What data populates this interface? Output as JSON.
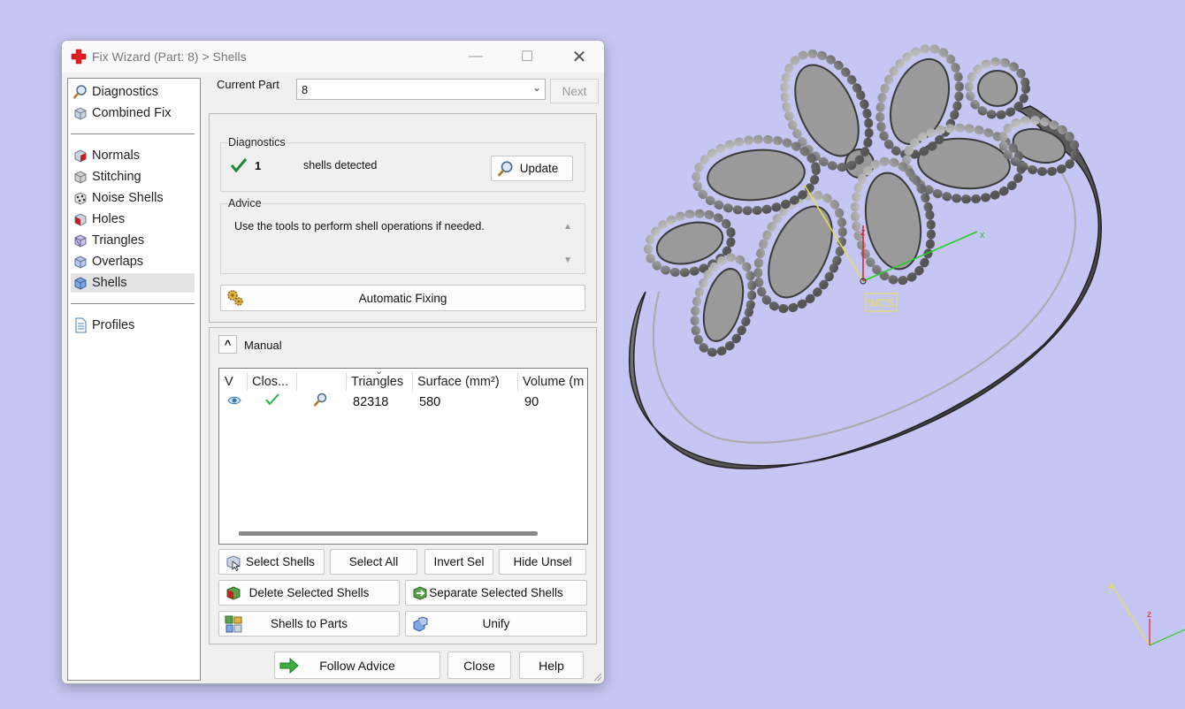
{
  "window": {
    "title": "Fix Wizard (Part: 8) > Shells",
    "min_symbol": "—",
    "max_symbol": "☐",
    "close_symbol": "✕"
  },
  "nav": {
    "group1": [
      {
        "label": "Diagnostics",
        "icon": "magnifier-icon"
      },
      {
        "label": "Combined Fix",
        "icon": "cube-icon"
      }
    ],
    "group2": [
      {
        "label": "Normals",
        "icon": "normals-cube-icon"
      },
      {
        "label": "Stitching",
        "icon": "stitching-cube-icon"
      },
      {
        "label": "Noise Shells",
        "icon": "noise-shells-icon"
      },
      {
        "label": "Holes",
        "icon": "holes-cube-icon"
      },
      {
        "label": "Triangles",
        "icon": "triangles-cube-icon"
      },
      {
        "label": "Overlaps",
        "icon": "overlaps-cube-icon"
      },
      {
        "label": "Shells",
        "icon": "shells-cube-icon",
        "selected": true
      }
    ],
    "group3": [
      {
        "label": "Profiles",
        "icon": "document-icon"
      }
    ]
  },
  "current_part": {
    "label": "Current Part",
    "value": "8",
    "next_label": "Next"
  },
  "diagnostics": {
    "title": "Diagnostics",
    "count": "1",
    "message": "shells detected",
    "update_label": "Update"
  },
  "advice": {
    "title": "Advice",
    "text": "Use the tools to perform shell operations if needed.",
    "scroll_up": "▲",
    "scroll_down": "▼"
  },
  "automatic_fixing_label": "Automatic Fixing",
  "manual": {
    "collapse_symbol": "^",
    "title": "Manual",
    "sort_indicator": "⌄",
    "columns": [
      "V",
      "Clos...",
      "",
      "Triangles",
      "Surface (mm²)",
      "Volume (m"
    ],
    "rows": [
      {
        "visible": "eye-icon",
        "closed": "check-icon",
        "inspect": "magnifier-icon",
        "triangles": "82318",
        "surface": "580",
        "volume": "90"
      }
    ],
    "buttons": {
      "select_shells": "Select Shells",
      "select_all": "Select All",
      "invert_sel": "Invert Sel",
      "hide_unsel": "Hide Unsel",
      "delete_selected": "Delete Selected Shells",
      "separate_selected": "Separate Selected Shells",
      "shells_to_parts": "Shells to Parts",
      "unify": "Unify"
    }
  },
  "bottom": {
    "follow_advice": "Follow Advice",
    "close": "Close",
    "help": "Help"
  },
  "viewport": {
    "wcs_label": "WCS",
    "axis_x": "x",
    "axis_z": "z",
    "mini_axis_z": "z",
    "mini_axis_y": "y",
    "colors": {
      "background": "#c6c6f4",
      "x_axis": "#22cc22",
      "y_axis": "#e8e050",
      "z_axis": "#dd2222"
    }
  }
}
